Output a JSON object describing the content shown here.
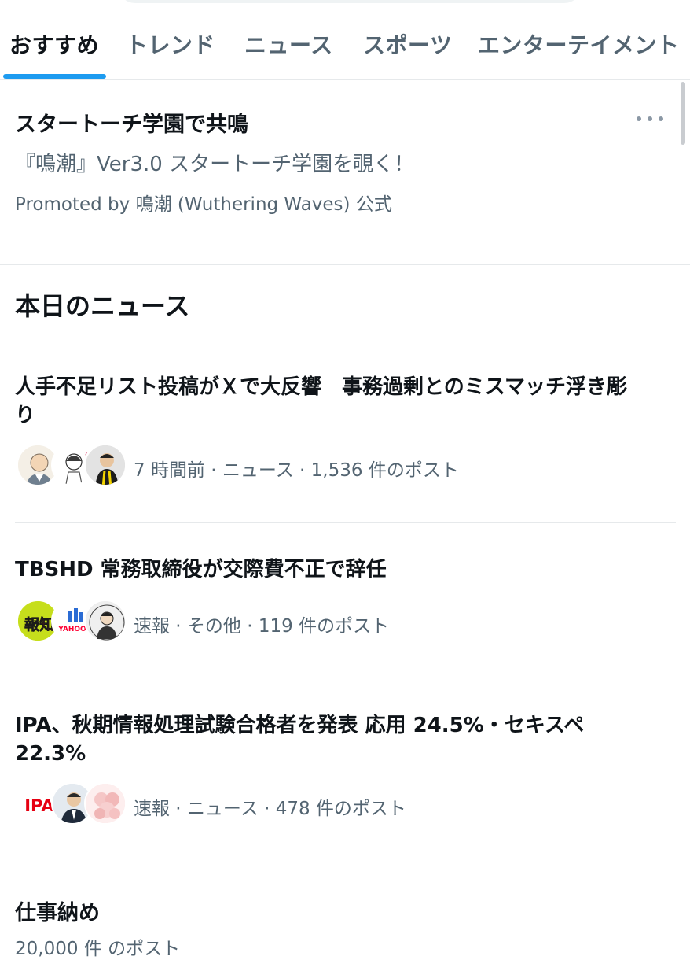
{
  "tabs": [
    {
      "label": "おすすめ"
    },
    {
      "label": "トレンド"
    },
    {
      "label": "ニュース"
    },
    {
      "label": "スポーツ"
    },
    {
      "label": "エンターテイメント"
    }
  ],
  "promo": {
    "title": "スタートーチ学園で共鳴",
    "description": "『鳴潮』Ver3.0 スタートーチ学園を覗く！",
    "promoted_by": "Promoted by 鳴潮 (Wuthering Waves) 公式"
  },
  "section": {
    "title": "本日のニュース"
  },
  "news": [
    {
      "headline": "人手不足リスト投稿がＸで大反響　事務過剰とのミスマッチ浮き彫り",
      "meta": "7 時間前 · ニュース · 1,536 件のポスト"
    },
    {
      "headline": "TBSHD 常務取締役が交際費不正で辞任",
      "meta": "速報 · その他 · 119 件のポスト"
    },
    {
      "headline": "IPA、秋期情報処理試験合格者を発表 応用 24.5%・セキスペ 22.3%",
      "meta": "速報 · ニュース · 478 件のポスト",
      "avatar_text": "IPA"
    }
  ],
  "avatar_labels": {
    "hochi": "報知",
    "yahoo": "YAHOO!"
  },
  "bottom": {
    "title": "仕事納め",
    "meta": "20,000 件 のポスト"
  },
  "colors": {
    "accent": "#1d9bf0",
    "secondary_text": "#536471",
    "divider": "#e6e9eb"
  }
}
